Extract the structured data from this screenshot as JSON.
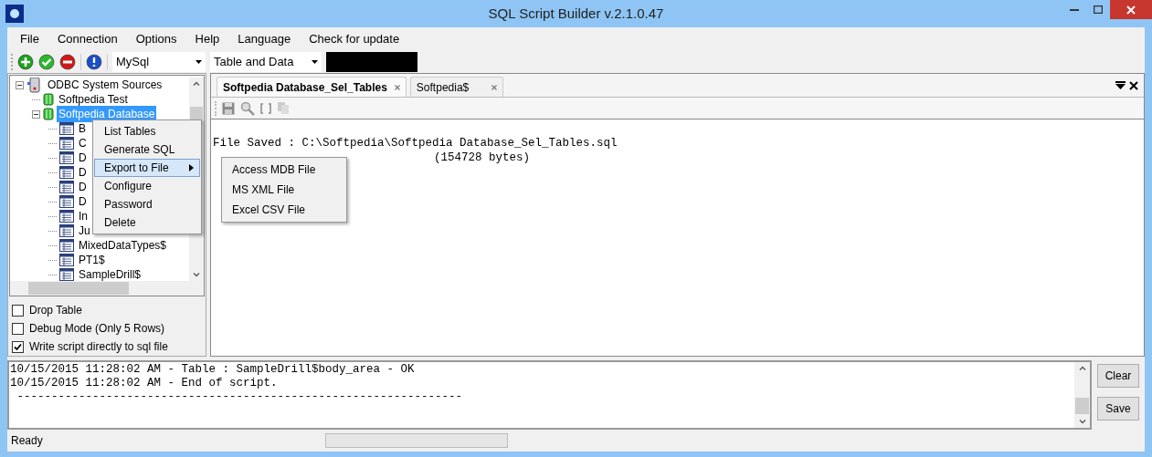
{
  "window": {
    "title": "SQL Script Builder v.2.1.0.47"
  },
  "menu": [
    "File",
    "Connection",
    "Options",
    "Help",
    "Language",
    "Check for update"
  ],
  "toolbar": {
    "database_type": "MySql",
    "script_mode": "Table and Data"
  },
  "tree": [
    {
      "label": "ODBC System Sources",
      "kind": "server",
      "expanded": true,
      "selected": false,
      "children": [
        {
          "label": "Softpedia Test",
          "kind": "database",
          "selected": false
        },
        {
          "label": "Softpedia Database",
          "kind": "database",
          "expanded": true,
          "selected": true,
          "children": [
            {
              "label": "B",
              "kind": "table",
              "selected": false
            },
            {
              "label": "C",
              "kind": "table",
              "selected": false
            },
            {
              "label": "D",
              "kind": "table",
              "selected": false
            },
            {
              "label": "D",
              "kind": "table",
              "selected": false
            },
            {
              "label": "D",
              "kind": "table",
              "selected": false
            },
            {
              "label": "D",
              "kind": "table",
              "selected": false
            },
            {
              "label": "In",
              "kind": "table",
              "selected": false
            },
            {
              "label": "Ju",
              "kind": "table",
              "selected": false
            },
            {
              "label": "MixedDataTypes$",
              "kind": "table",
              "selected": false
            },
            {
              "label": "PT1$",
              "kind": "table",
              "selected": false
            },
            {
              "label": "SampleDrill$",
              "kind": "table",
              "selected": false
            }
          ]
        }
      ]
    }
  ],
  "context_menu": [
    {
      "label": "List Tables",
      "selected": false
    },
    {
      "label": "Generate SQL",
      "selected": false
    },
    {
      "label": "Export to File",
      "selected": true,
      "submenu": [
        "Access MDB File",
        "MS XML File",
        "Excel CSV File"
      ]
    },
    {
      "label": "Configure",
      "selected": false
    },
    {
      "label": "Password",
      "selected": false
    },
    {
      "label": "Delete",
      "selected": false
    }
  ],
  "options": [
    {
      "label": "Drop Table",
      "checked": false
    },
    {
      "label": "Debug Mode (Only 5 Rows)",
      "checked": false
    },
    {
      "label": "Write script directly to sql file",
      "checked": true
    }
  ],
  "tabs": [
    {
      "label": "Softpedia Database_Sel_Tables",
      "selected": true
    },
    {
      "label": "Softpedia$",
      "selected": false
    }
  ],
  "editor": {
    "lines": [
      "File Saved : C:\\Softpedia\\Softpedia Database_Sel_Tables.sql",
      "(154728 bytes)"
    ]
  },
  "log": {
    "lines": [
      "10/15/2015 11:28:02 AM - Table : SampleDrill$body_area - OK",
      "10/15/2015 11:28:02 AM - End of script.",
      " -----------------------------------------------------------------"
    ]
  },
  "buttons": [
    "Clear",
    "Save"
  ],
  "status_bar": {
    "text": "Ready",
    "progress": {
      "level": 0
    }
  }
}
